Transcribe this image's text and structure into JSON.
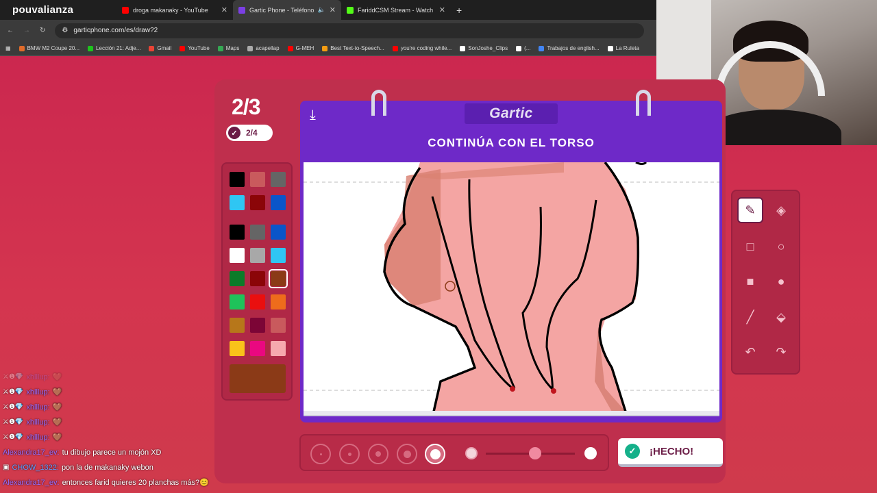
{
  "browser": {
    "brand": "pouvalianza",
    "tabs": [
      {
        "title": "droga makanaky - YouTube",
        "color": "#ff0000",
        "sound": false
      },
      {
        "title": "Gartic Phone - Teléfono De",
        "color": "#7b3fe4",
        "sound": true,
        "active": true
      },
      {
        "title": "FariddCSM Stream - Watch Live",
        "color": "#53fc18",
        "sound": false
      }
    ],
    "url": "garticphone.com/es/draw?2",
    "bookmarks": [
      {
        "label": "BMW M2 Coupe 20...",
        "color": "#e06b2a"
      },
      {
        "label": "Lección 21: Adje...",
        "color": "#1ec41e"
      },
      {
        "label": "Gmail",
        "color": "#ea4335"
      },
      {
        "label": "YouTube",
        "color": "#ff0000"
      },
      {
        "label": "Maps",
        "color": "#34a853"
      },
      {
        "label": "acapellap",
        "color": "#aaaaaa"
      },
      {
        "label": "G-MEH",
        "color": "#ff0000"
      },
      {
        "label": "Best Text-to-Speech...",
        "color": "#f39c12"
      },
      {
        "label": "you're coding while...",
        "color": "#ff0000"
      },
      {
        "label": "SonJoshe_Clips",
        "color": "#ffffff"
      },
      {
        "label": "(...",
        "color": "#ffffff"
      },
      {
        "label": "Trabajos de english...",
        "color": "#4285f4"
      },
      {
        "label": "La Ruleta",
        "color": "#ffffff"
      }
    ]
  },
  "game": {
    "round": "2/3",
    "progress": "2/4",
    "logo": "Gartic",
    "instruction": "CONTINÚA CON EL TORSO",
    "done_label": "¡HECHO!",
    "palette": {
      "row_top": [
        "#000000",
        "#c95a5d",
        "#656565",
        "#2fc6f3",
        "#8b0508",
        "#0a55c9"
      ],
      "grid": [
        "#000000",
        "#656565",
        "#0a55c9",
        "#ffffff",
        "#a8a8a8",
        "#2fc6f3",
        "#0c7b29",
        "#8b0508",
        "#8b3a17",
        "#1ec35a",
        "#ea0f0f",
        "#ee6c1c",
        "#b7771a",
        "#7c0536",
        "#c95a5d",
        "#f9c21a",
        "#ea0880",
        "#f6a9ae"
      ],
      "selected_color": "#8b3a17"
    },
    "tools": [
      "pencil-icon",
      "eraser-icon",
      "rect-outline-icon",
      "ellipse-outline-icon",
      "rect-fill-icon",
      "ellipse-fill-icon",
      "line-icon",
      "bucket-icon",
      "undo-icon",
      "redo-icon"
    ],
    "brush_sizes": [
      1,
      2,
      3,
      4,
      5
    ],
    "selected_size": 5,
    "opacity": 0.55
  },
  "chat": [
    {
      "user": "xhlllup:",
      "msg": "🤎",
      "color": "#9a6cff",
      "faded": true
    },
    {
      "user": "xhlllup:",
      "msg": "🤎",
      "color": "#9a6cff"
    },
    {
      "user": "xhlllup:",
      "msg": "🤎",
      "color": "#9a6cff"
    },
    {
      "user": "xhlllup:",
      "msg": "🤎",
      "color": "#9a6cff"
    },
    {
      "user": "xhlllup:",
      "msg": "🤎",
      "color": "#9a6cff"
    },
    {
      "user": "Alexandra17_ev:",
      "msg": "tu dibujo parece un mojón XD",
      "color": "#9a6cff"
    },
    {
      "user": "CHOW_1322:",
      "msg": "pon la de makanaky webon",
      "color": "#5f9cff"
    },
    {
      "user": "Alexandra17_ev:",
      "msg": "entonces farid quieres 20 planchas más?😊",
      "color": "#9a6cff"
    }
  ]
}
